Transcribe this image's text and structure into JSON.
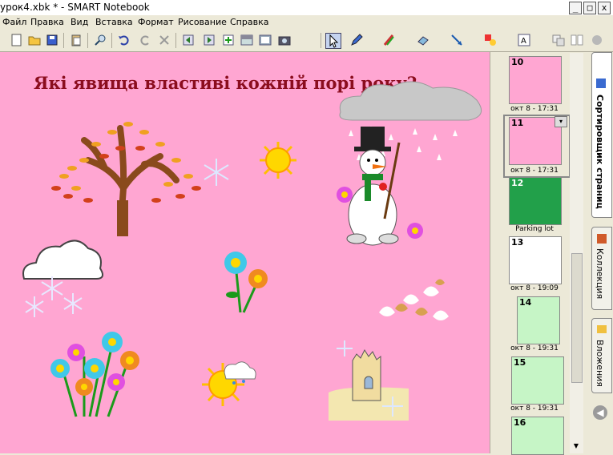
{
  "window": {
    "title": "урок4.xbk * - SMART Notebook",
    "min": "_",
    "max": "□",
    "close": "x"
  },
  "menu": [
    "Файл",
    "Правка",
    "Вид",
    "Вставка",
    "Формат",
    "Рисование",
    "Справка"
  ],
  "page": {
    "question": "Які явища властиві кожній порі року?"
  },
  "thumbnails": [
    {
      "num": "10",
      "label": "окт 8 - 17:31",
      "bg": "#ffa6d2"
    },
    {
      "num": "11",
      "label": "окт 8 - 17:31",
      "bg": "#ffa6d2"
    },
    {
      "num": "12",
      "label": "Parking lot",
      "bg": "#22a04a"
    },
    {
      "num": "13",
      "label": "окт 8 - 19:09",
      "bg": "#ffffff"
    },
    {
      "num": "14",
      "label": "окт 8 - 19:31",
      "bg": "#c6f5c6"
    },
    {
      "num": "15",
      "label": "окт 8 - 19:31",
      "bg": "#c6f5c6"
    },
    {
      "num": "16",
      "label": "",
      "bg": "#c6f5c6"
    }
  ],
  "tabs": [
    "Сортировщик страниц",
    "Коллекция",
    "Вложения"
  ],
  "colors": {
    "canvas": "#ffa6d2",
    "title": "#8b0d1e"
  }
}
